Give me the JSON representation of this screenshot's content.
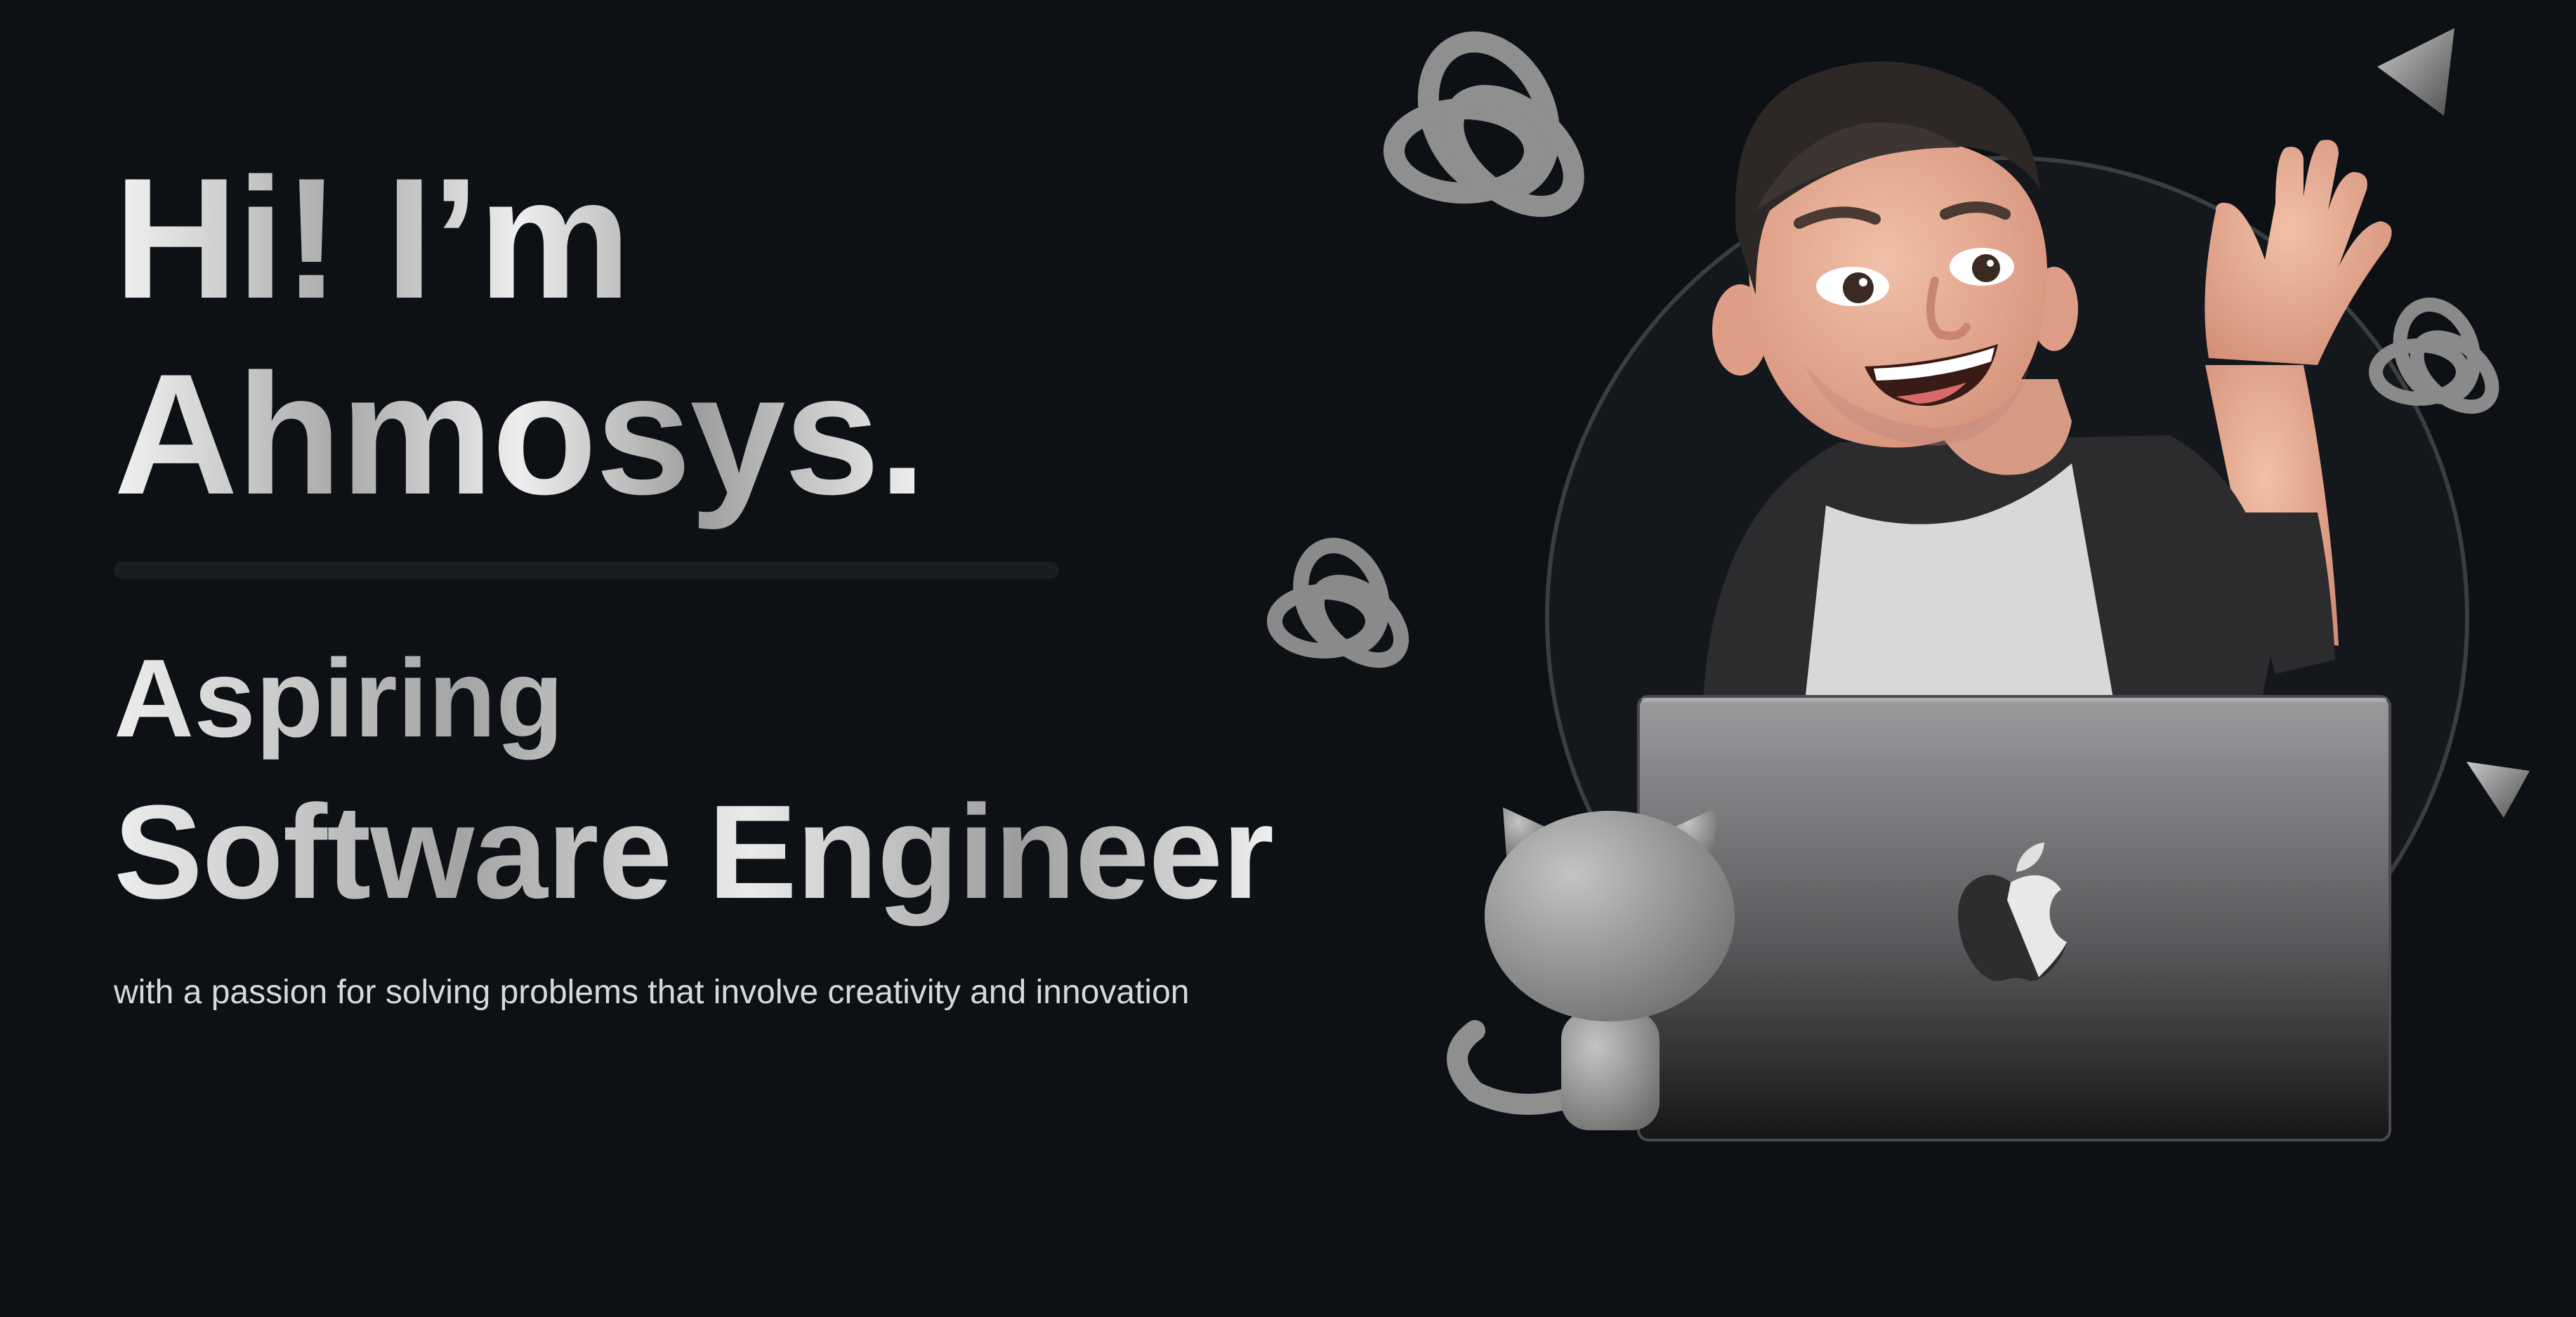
{
  "hero": {
    "greeting_line_1": "Hi! I’m",
    "greeting_line_2": "Ahmosys.",
    "role_line_1": "Aspiring",
    "role_line_2": "Software Engineer",
    "tagline": "with a passion for solving problems that involve creativity and innovation"
  },
  "colors": {
    "background": "#0d1014",
    "divider": "#1a1d22",
    "text_light": "#e8e8e8",
    "tagline": "#d9d9d9"
  },
  "icons": {
    "avatar": "memoji-avatar-waving",
    "laptop": "laptop-with-apple-logo",
    "mascot": "octocat-mascot",
    "decor": [
      "torus-knot-shape",
      "cone-shape"
    ]
  }
}
